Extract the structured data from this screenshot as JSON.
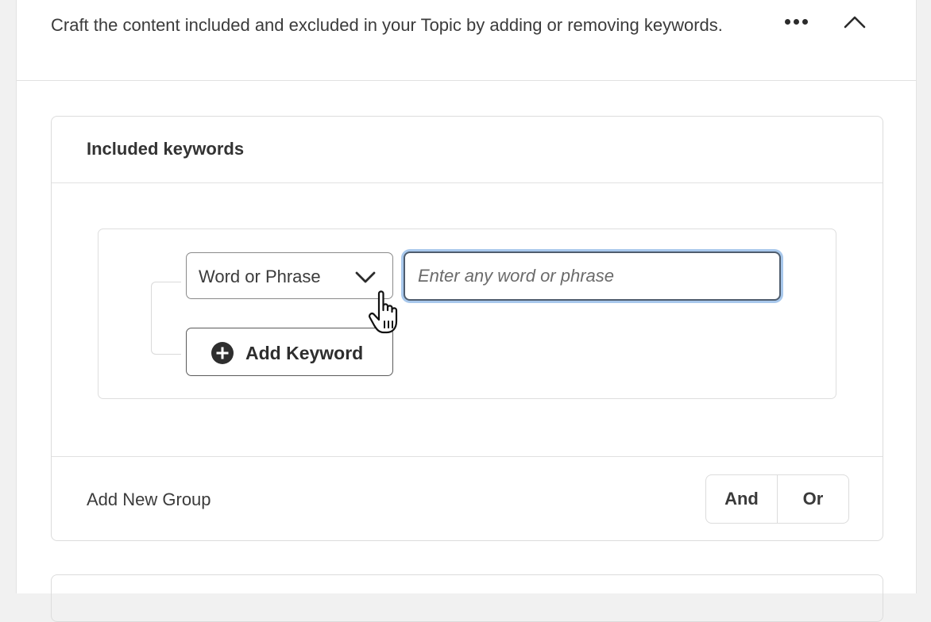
{
  "header": {
    "description": "Craft the content included and excluded in your Topic by adding or removing keywords.",
    "more_icon": "more-horizontal-icon",
    "collapse_icon": "chevron-up-icon"
  },
  "included_card": {
    "title": "Included keywords",
    "keyword_row": {
      "type_selected": "Word or Phrase",
      "type_icon": "chevron-down-icon",
      "input_value": "",
      "input_placeholder": "Enter any word or phrase"
    },
    "add_keyword_label": "Add Keyword",
    "add_keyword_icon": "plus-circle-icon",
    "footer": {
      "add_group_label": "Add New Group",
      "logic_options": [
        "And",
        "Or"
      ]
    }
  },
  "cursor": "hand-pointer-icon",
  "colors": {
    "focus_ring": "#a8c8ec",
    "focus_border": "#4f5d6e"
  }
}
